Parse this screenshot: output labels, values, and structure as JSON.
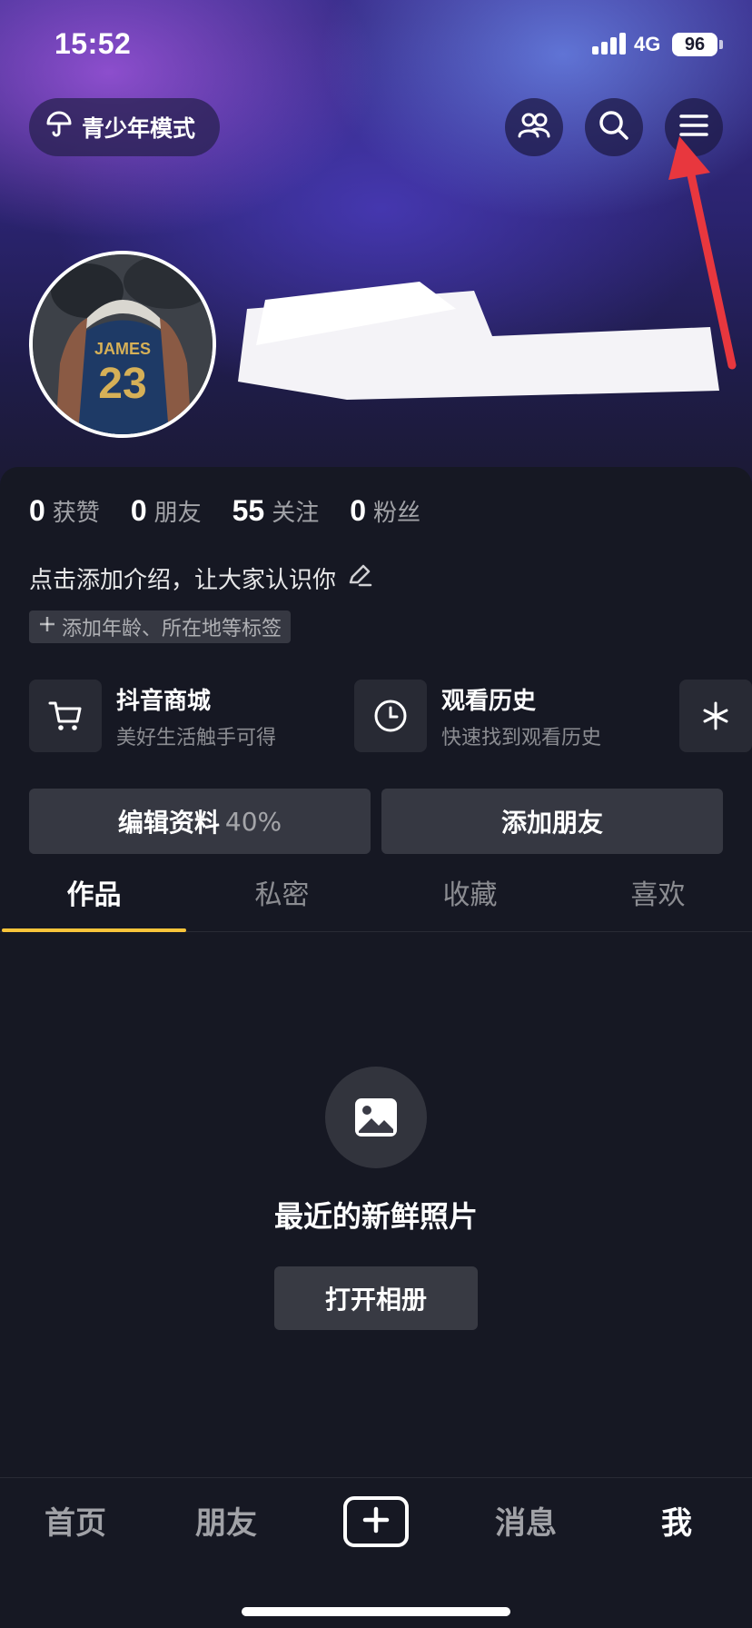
{
  "status_bar": {
    "time": "15:52",
    "network": "4G",
    "battery": "96"
  },
  "top_bar": {
    "teen_mode_label": "青少年模式",
    "icons": [
      "umbrella-icon",
      "friends-icon",
      "search-icon",
      "menu-icon"
    ]
  },
  "stats": [
    {
      "num": "0",
      "label": "获赞"
    },
    {
      "num": "0",
      "label": "朋友"
    },
    {
      "num": "55",
      "label": "关注"
    },
    {
      "num": "0",
      "label": "粉丝"
    }
  ],
  "profile": {
    "bio_prompt": "点击添加介绍，让大家认识你",
    "tag_prompt": "添加年龄、所在地等标签"
  },
  "shortcuts": [
    {
      "title": "抖音商城",
      "subtitle": "美好生活触手可得",
      "icon": "cart-icon"
    },
    {
      "title": "观看历史",
      "subtitle": "快速找到观看历史",
      "icon": "clock-icon"
    }
  ],
  "actions": {
    "edit_profile": "编辑资料",
    "edit_profile_pct": "40%",
    "add_friend": "添加朋友"
  },
  "tabs": [
    "作品",
    "私密",
    "收藏",
    "喜欢"
  ],
  "active_tab": "作品",
  "empty_state": {
    "title": "最近的新鲜照片",
    "button": "打开相册"
  },
  "bottom_nav": {
    "items": [
      "首页",
      "朋友",
      "消息",
      "我"
    ],
    "active": "我"
  },
  "colors": {
    "background": "#161823",
    "tab_indicator": "#f8c43a",
    "annotation_arrow": "#e8373e"
  }
}
